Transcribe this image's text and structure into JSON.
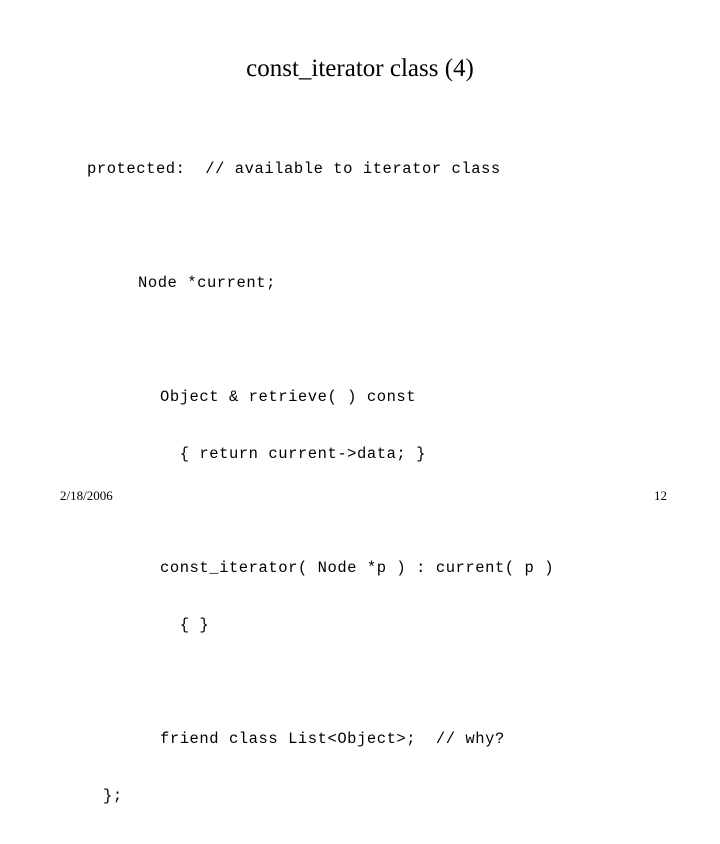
{
  "slide": {
    "title": "const_iterator class (4)",
    "background_color": "#ffffff",
    "text_color": "#000000",
    "code_lines": [
      {
        "indent": 0,
        "text": "protected:  // available to iterator class"
      },
      {
        "indent": 0,
        "text": ""
      },
      {
        "indent": 2,
        "text": "Node *current;"
      },
      {
        "indent": 0,
        "text": ""
      },
      {
        "indent": 3,
        "text": "Object & retrieve( ) const"
      },
      {
        "indent": 3,
        "text": "  { return current->data; }"
      },
      {
        "indent": 0,
        "text": ""
      },
      {
        "indent": 3,
        "text": "const_iterator( Node *p ) : current( p )"
      },
      {
        "indent": 3,
        "text": "  { }"
      },
      {
        "indent": 0,
        "text": ""
      },
      {
        "indent": 3,
        "text": "friend class List<Object>;  // why?"
      },
      {
        "indent": 1,
        "text": "};"
      }
    ]
  },
  "footer": {
    "date": "2/18/2006",
    "page_number": "12"
  }
}
